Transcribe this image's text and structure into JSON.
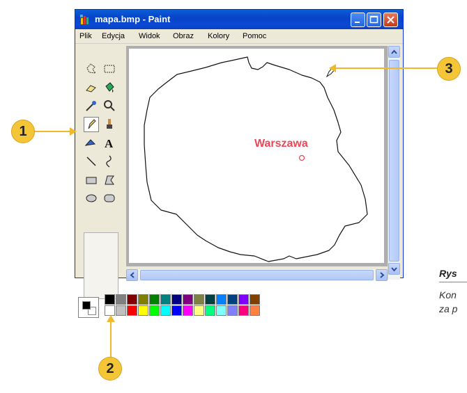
{
  "window": {
    "title": "mapa.bmp - Paint"
  },
  "menu": [
    "Plik",
    "Edycja",
    "Widok",
    "Obraz",
    "Kolory",
    "Pomoc"
  ],
  "canvas": {
    "label": "Warszawa",
    "label_color": "#e8485a"
  },
  "toolbox": {
    "tools": [
      "free-select-icon",
      "rect-select-icon",
      "eraser-icon",
      "fill-bucket-icon",
      "color-picker-icon",
      "magnifier-icon",
      "pencil-icon",
      "brush-icon",
      "airbrush-icon",
      "text-icon",
      "line-icon",
      "curve-icon",
      "rectangle-icon",
      "polygon-icon",
      "ellipse-icon",
      "rounded-rectangle-icon"
    ],
    "selected": "pencil-icon"
  },
  "palette": {
    "foreground": "#000000",
    "background": "#ffffff",
    "row1": [
      "#000000",
      "#808080",
      "#800000",
      "#808000",
      "#008000",
      "#008080",
      "#000080",
      "#800080",
      "#808040",
      "#004040",
      "#0080ff",
      "#004080",
      "#8000ff",
      "#804000"
    ],
    "row2": [
      "#ffffff",
      "#c0c0c0",
      "#ff0000",
      "#ffff00",
      "#00ff00",
      "#00ffff",
      "#0000ff",
      "#ff00ff",
      "#ffff80",
      "#00ff80",
      "#80ffff",
      "#8080ff",
      "#ff0080",
      "#ff8040"
    ]
  },
  "callouts": [
    "1",
    "2",
    "3"
  ],
  "caption": {
    "title": "Rys",
    "line1": "Kon",
    "line2": "za p"
  }
}
